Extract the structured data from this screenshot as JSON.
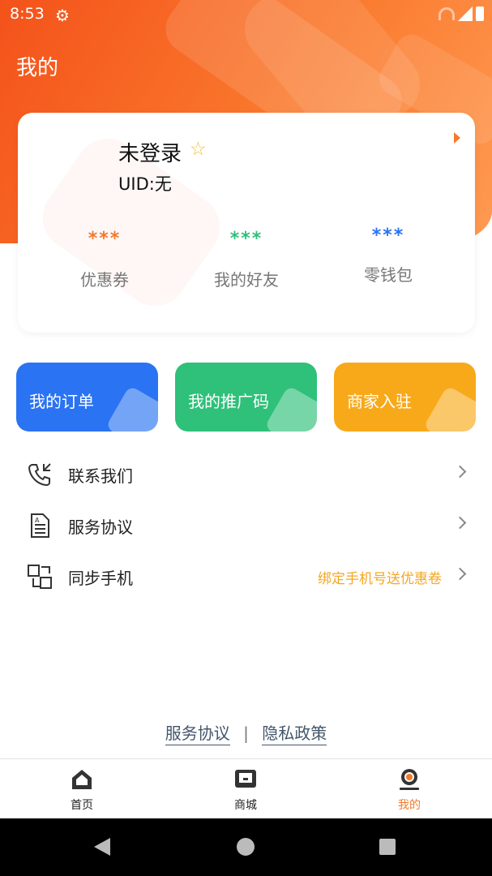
{
  "status_bar": {
    "time": "8:53"
  },
  "header": {
    "title": "我的"
  },
  "user": {
    "name": "未登录",
    "uid_label": "UID:",
    "uid_value": "无"
  },
  "stats": [
    {
      "value": "***",
      "label": "优惠券",
      "color": "#f07a2e"
    },
    {
      "value": "***",
      "label": "我的好友",
      "color": "#2fc07a"
    },
    {
      "value": "***",
      "label": "零钱包",
      "color": "#2a73f2"
    }
  ],
  "features": [
    {
      "label": "我的订单",
      "color": "#2a73f2"
    },
    {
      "label": "我的推广码",
      "color": "#2fc07a"
    },
    {
      "label": "商家入驻",
      "color": "#f8a91a"
    }
  ],
  "menu": [
    {
      "label": "联系我们",
      "extra": "",
      "icon": "phone-transfer-icon"
    },
    {
      "label": "服务协议",
      "extra": "",
      "icon": "document-icon"
    },
    {
      "label": "同步手机",
      "extra": "绑定手机号送优惠卷",
      "icon": "sync-phone-icon"
    }
  ],
  "footer": {
    "link1": "服务协议",
    "separator": "|",
    "link2": "隐私政策"
  },
  "tabs": [
    {
      "label": "首页",
      "icon": "home-icon"
    },
    {
      "label": "商城",
      "icon": "shop-icon"
    },
    {
      "label": "我的",
      "icon": "profile-icon",
      "active": true
    }
  ],
  "colors": {
    "accent": "#f47a2a",
    "header": "#f4521a"
  }
}
